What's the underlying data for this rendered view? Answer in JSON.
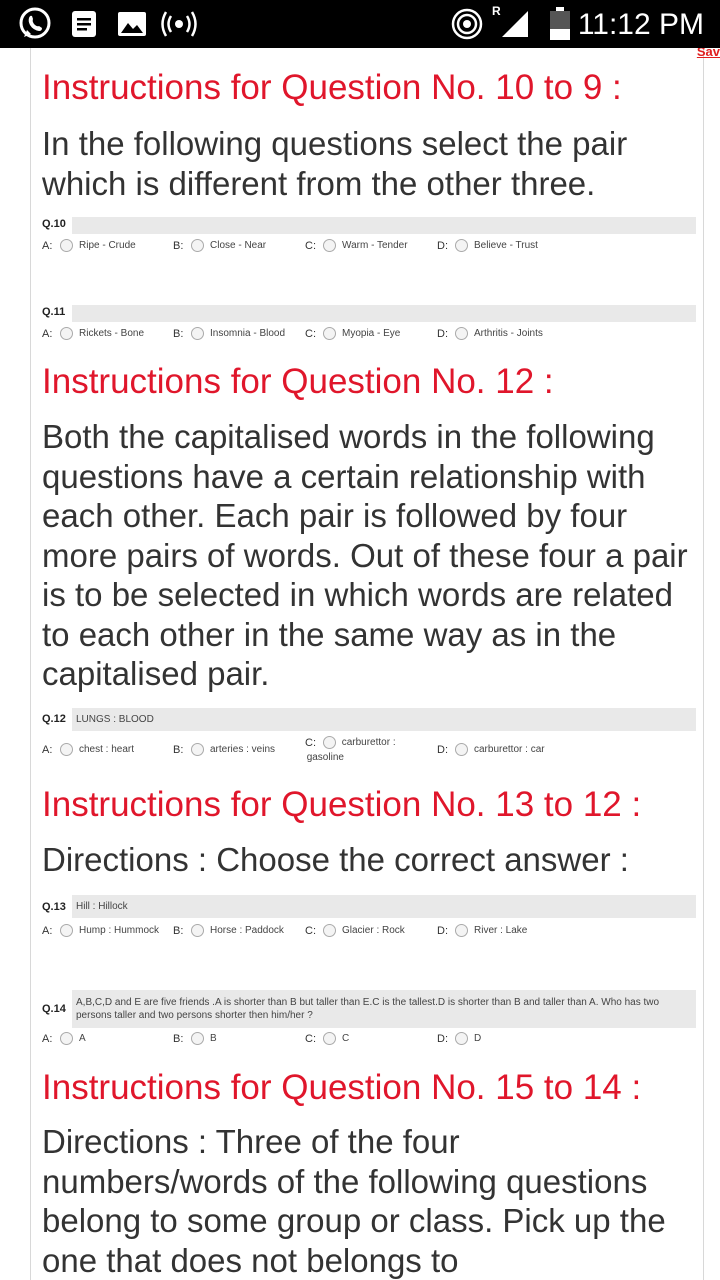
{
  "status_bar": {
    "time": "11:12 PM"
  },
  "toolbar": {
    "save_label": "Sav"
  },
  "sections": [
    {
      "instruction": "Instructions for Question No. 10 to 9 :",
      "direction": "In the following questions select the pair which is different from the other three."
    },
    {
      "instruction": "Instructions for Question No. 12 :",
      "direction": "Both the capitalised words in the following questions have a certain relationship with each other. Each pair is followed by four more pairs of words. Out of these four a pair is to be selected in which words are related to each other in the same way as in the capitalised pair."
    },
    {
      "instruction": "Instructions for Question No. 13 to 12 :",
      "direction": "Directions : Choose the correct answer :"
    },
    {
      "instruction": "Instructions for Question No. 15 to 14 :",
      "direction": "Directions : Three of the four numbers/words of the following questions belong to some group or class. Pick up the one that does not belongs to"
    }
  ],
  "questions": [
    {
      "num": "Q.10",
      "text": "",
      "options": [
        {
          "letter": "A:",
          "text": "Ripe - Crude"
        },
        {
          "letter": "B:",
          "text": "Close - Near"
        },
        {
          "letter": "C:",
          "text": "Warm - Tender"
        },
        {
          "letter": "D:",
          "text": "Believe - Trust"
        }
      ]
    },
    {
      "num": "Q.11",
      "text": "",
      "options": [
        {
          "letter": "A:",
          "text": "Rickets - Bone"
        },
        {
          "letter": "B:",
          "text": "Insomnia - Blood"
        },
        {
          "letter": "C:",
          "text": "Myopia - Eye"
        },
        {
          "letter": "D:",
          "text": "Arthritis - Joints"
        }
      ]
    },
    {
      "num": "Q.12",
      "text": "LUNGS : BLOOD",
      "options": [
        {
          "letter": "A:",
          "text": "chest : heart"
        },
        {
          "letter": "B:",
          "text": "arteries : veins"
        },
        {
          "letter": "C:",
          "text": "carburettor : gasoline"
        },
        {
          "letter": "D:",
          "text": "carburettor : car"
        }
      ]
    },
    {
      "num": "Q.13",
      "text": "Hill : Hillock",
      "options": [
        {
          "letter": "A:",
          "text": "Hump : Hummock"
        },
        {
          "letter": "B:",
          "text": "Horse : Paddock"
        },
        {
          "letter": "C:",
          "text": "Glacier : Rock"
        },
        {
          "letter": "D:",
          "text": "River : Lake"
        }
      ]
    },
    {
      "num": "Q.14",
      "text": "A,B,C,D and E are five friends .A is shorter than B but taller than E.C is the tallest.D is shorter than B and taller than A. Who has two persons taller and two persons shorter then him/her ?",
      "options": [
        {
          "letter": "A:",
          "text": "A"
        },
        {
          "letter": "B:",
          "text": "B"
        },
        {
          "letter": "C:",
          "text": "C"
        },
        {
          "letter": "D:",
          "text": "D"
        }
      ]
    }
  ]
}
